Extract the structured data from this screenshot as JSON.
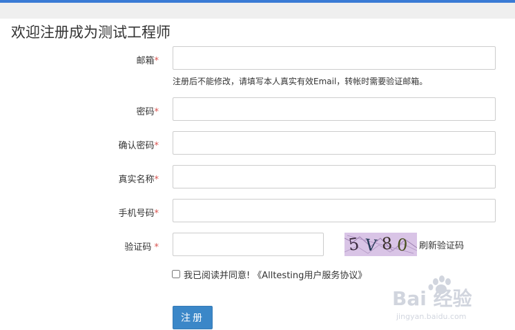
{
  "page": {
    "title": "欢迎注册成为测试工程师"
  },
  "form": {
    "required_mark": "*",
    "email": {
      "label": "邮箱",
      "value": "",
      "help": "注册后不能修改，请填写本人真实有效Email，转帐时需要验证邮箱。"
    },
    "password": {
      "label": "密码",
      "value": ""
    },
    "confirm_password": {
      "label": "确认密码",
      "value": ""
    },
    "real_name": {
      "label": "真实名称",
      "value": ""
    },
    "phone": {
      "label": "手机号码",
      "value": ""
    },
    "captcha": {
      "label": "验证码 ",
      "value": "",
      "code": "5V80",
      "refresh_label": "刷新验证码"
    },
    "agreement": {
      "checked": false,
      "text": "我已阅读并同意!",
      "link_label": "《Alltesting用户服务协议》"
    },
    "submit_label": "注册"
  },
  "watermark": {
    "brand": "Bai 经验",
    "url": "jingyan.baidu.com"
  },
  "colors": {
    "accent": "#3a7bd5",
    "button": "#3b87c8",
    "required": "#d9534f",
    "captcha_bg": "#d9c4e6"
  }
}
